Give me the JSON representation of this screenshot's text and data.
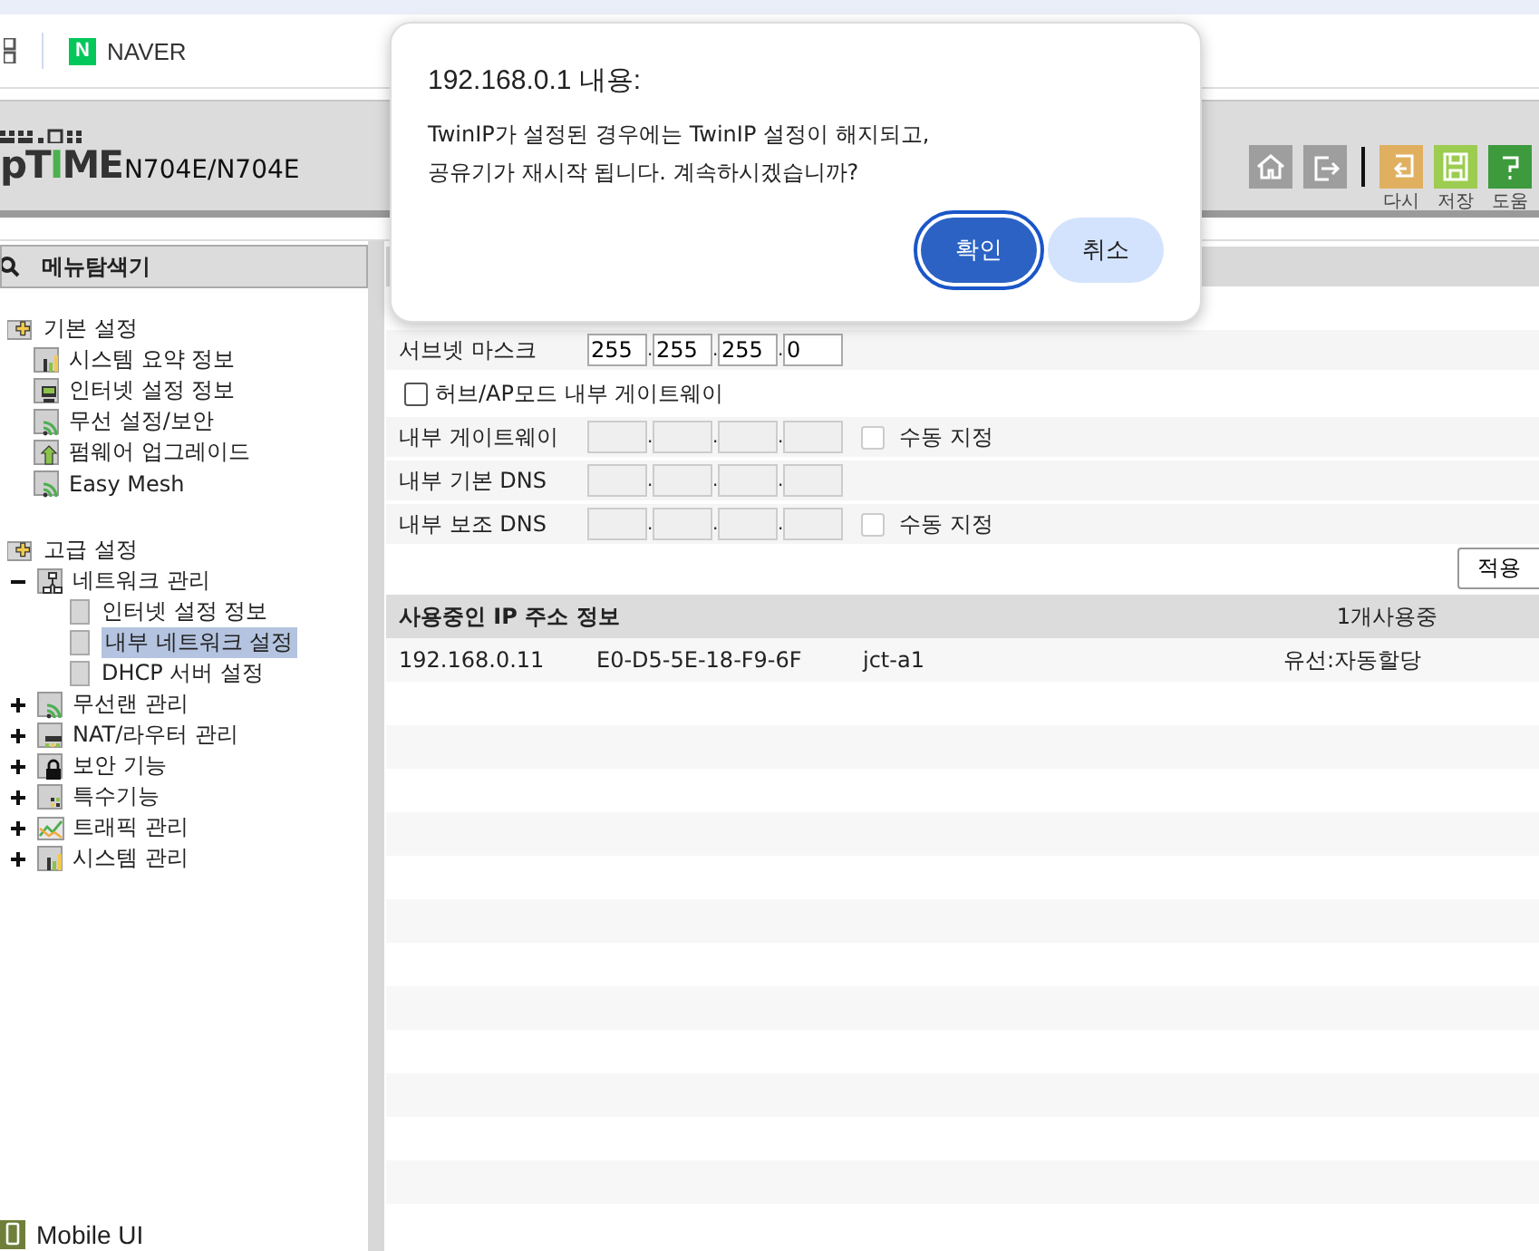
{
  "browser": {
    "bookmark": {
      "logo_letter": "N",
      "label": "NAVER"
    }
  },
  "header": {
    "logo": {
      "lead": "p",
      "word_1": "T",
      "accent": "I",
      "word_2": "ME"
    },
    "model": "N704E/N704E",
    "tools": [
      {
        "kind": "home"
      },
      {
        "kind": "logout"
      },
      {
        "kind": "reset",
        "label": "다시"
      },
      {
        "kind": "save",
        "label": "저장"
      },
      {
        "kind": "help",
        "label": "도움"
      }
    ]
  },
  "sidebar": {
    "title": "메뉴탐색기",
    "tree": [
      {
        "label": "기본 설정",
        "kind": "folder",
        "children": [
          {
            "label": "시스템 요약 정보",
            "kind": "chart"
          },
          {
            "label": "인터넷 설정 정보",
            "kind": "monitor"
          },
          {
            "label": "무선 설정/보안",
            "kind": "wifi"
          },
          {
            "label": "펌웨어 업그레이드",
            "kind": "upgrade"
          },
          {
            "label": "Easy Mesh",
            "kind": "wifi"
          }
        ]
      },
      {
        "label": "고급 설정",
        "kind": "folder",
        "children": [
          {
            "label": "네트워크 관리",
            "kind": "network",
            "expanded": true,
            "children": [
              {
                "label": "인터넷 설정 정보",
                "kind": "page",
                "selected": false
              },
              {
                "label": "내부 네트워크 설정",
                "kind": "page",
                "selected": true
              },
              {
                "label": "DHCP 서버 설정",
                "kind": "page",
                "selected": false
              }
            ]
          },
          {
            "label": "무선랜 관리",
            "kind": "wifi",
            "expanded": false
          },
          {
            "label": "NAT/라우터 관리",
            "kind": "router",
            "expanded": false
          },
          {
            "label": "보안 기능",
            "kind": "lock",
            "expanded": false
          },
          {
            "label": "특수기능",
            "kind": "special",
            "expanded": false
          },
          {
            "label": "트래픽 관리",
            "kind": "traffic",
            "expanded": false
          },
          {
            "label": "시스템 관리",
            "kind": "chart",
            "expanded": false
          }
        ]
      }
    ],
    "footer": "Mobile UI"
  },
  "form": {
    "rows": [
      {
        "kind": "ip",
        "label": "서브넷 마스크",
        "disabled": false,
        "octets": [
          "255",
          "255",
          "255",
          "0"
        ]
      },
      {
        "kind": "checkbox",
        "label": "허브/AP모드 내부 게이트웨이",
        "checked": false
      },
      {
        "kind": "ip",
        "label": "내부 게이트웨이",
        "disabled": true,
        "manual": {
          "label": "수동 지정",
          "checked": false
        }
      },
      {
        "kind": "ip",
        "label": "내부 기본 DNS",
        "disabled": true
      },
      {
        "kind": "ip",
        "label": "내부 보조 DNS",
        "disabled": true,
        "manual": {
          "label": "수동 지정",
          "checked": false
        }
      }
    ],
    "separator": ".",
    "apply": "적용"
  },
  "table": {
    "title": "사용중인 IP 주소 정보",
    "count": "1개사용중",
    "rows": [
      {
        "ip": "192.168.0.11",
        "mac": "E0-D5-5E-18-F9-6F",
        "name": "jct-a1",
        "type": "유선:자동할당"
      }
    ]
  },
  "dialog": {
    "title": "192.168.0.1 내용:",
    "message": [
      "TwinIP가 설정된 경우에는 TwinIP 설정이 해지되고,",
      "공유기가 재시작 됩니다. 계속하시겠습니까?"
    ],
    "buttons": [
      {
        "label": "확인",
        "kind": "primary"
      },
      {
        "label": "취소",
        "kind": "secondary"
      }
    ]
  }
}
